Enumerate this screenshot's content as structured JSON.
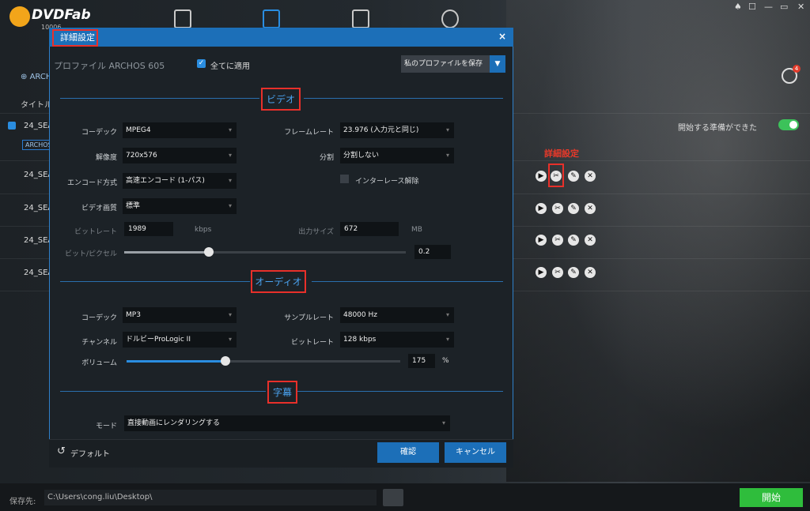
{
  "app": {
    "logo_text": "DVDFab",
    "logo_sub": "10006",
    "window_controls": [
      "♠",
      "☐",
      "—",
      "▭",
      "✕"
    ]
  },
  "main": {
    "profile_tag": "ARCHOS",
    "column_title": "タイトル",
    "titles": [
      "24_SEA",
      "24_SEA",
      "24_SEA",
      "24_SEA",
      "24_SEA"
    ],
    "archos_badge": "ARCHOS",
    "ready_text": "開始する準備ができた",
    "badge_count": "4",
    "advanced_label": "詳細設定"
  },
  "footer": {
    "save_label": "保存先:",
    "path": "C:\\Users\\cong.liu\\Desktop\\",
    "start_button": "開始"
  },
  "dialog": {
    "title": "詳細設定",
    "close": "×",
    "profile_name": "プロファイル ARCHOS 605",
    "apply_all": "全てに適用",
    "save_profile": "私のプロファイルを保存",
    "video": {
      "section": "ビデオ",
      "codec_label": "コーデック",
      "codec": "MPEG4",
      "framerate_label": "フレームレート",
      "framerate": "23.976 (入力元と同じ)",
      "resolution_label": "解像度",
      "resolution": "720x576",
      "split_label": "分割",
      "split": "分割しない",
      "encode_label": "エンコード方式",
      "encode": "高速エンコード (1-パス)",
      "deinterlace_label": "インターレース解除",
      "quality_label": "ビデオ画質",
      "quality": "標準",
      "bitrate_label": "ビットレート",
      "bitrate": "1989",
      "bitrate_unit": "kbps",
      "output_label": "出力サイズ",
      "output": "672",
      "output_unit": "MB",
      "bpp_label": "ビット/ピクセル",
      "bpp": "0.2",
      "bpp_slider": 0.3
    },
    "audio": {
      "section": "オーディオ",
      "codec_label": "コーデック",
      "codec": "MP3",
      "samplerate_label": "サンプルレート",
      "samplerate": "48000 Hz",
      "channel_label": "チャンネル",
      "channel": "ドルビーProLogic II",
      "bitrate_label": "ビットレート",
      "bitrate": "128 kbps",
      "volume_label": "ボリューム",
      "volume": "175",
      "volume_unit": "%",
      "volume_slider": 0.36
    },
    "subtitle": {
      "section": "字幕",
      "mode_label": "モード",
      "mode": "直接動画にレンダリングする"
    },
    "default_label": "デフォルト",
    "ok": "確認",
    "cancel": "キャンセル"
  }
}
